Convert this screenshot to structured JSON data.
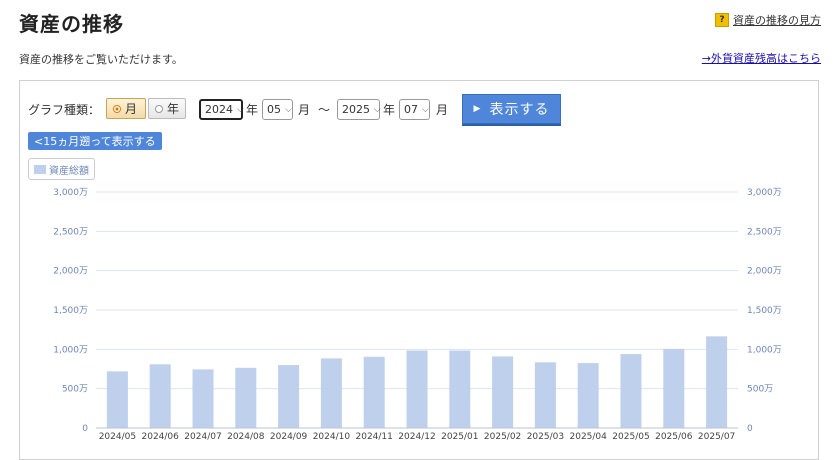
{
  "header": {
    "title": "資産の推移",
    "help_label": "資産の推移の見方",
    "help_icon": "question-icon",
    "subtitle": "資産の推移をご覧いただけます。",
    "fx_link": "→外貨資産残高はこちら"
  },
  "controls": {
    "graph_type_label": "グラフ種類：",
    "radio_month": "月",
    "radio_year": "年",
    "selected": "月",
    "from_year": "2024",
    "from_month": "05",
    "to_year": "2025",
    "to_month": "07",
    "year_unit": "年",
    "month_unit": "月",
    "range_sep": "〜",
    "show_button": "表示する",
    "back_button": "<15ヵ月遡って表示する"
  },
  "chart_data": {
    "type": "bar",
    "legend": [
      "資産総額"
    ],
    "categories": [
      "2024/05",
      "2024/06",
      "2024/07",
      "2024/08",
      "2024/09",
      "2024/10",
      "2024/11",
      "2024/12",
      "2025/01",
      "2025/02",
      "2025/03",
      "2025/04",
      "2025/05",
      "2025/06",
      "2025/07"
    ],
    "series": [
      {
        "name": "資産総額",
        "values": [
          720,
          810,
          745,
          765,
          800,
          885,
          905,
          985,
          985,
          910,
          835,
          825,
          940,
          1005,
          1165
        ]
      }
    ],
    "ylim": [
      0,
      3000
    ],
    "yticks": [
      "0",
      "500万",
      "1,000万",
      "1,500万",
      "2,000万",
      "2,500万",
      "3,000万"
    ],
    "ytick_values": [
      0,
      500,
      1000,
      1500,
      2000,
      2500,
      3000
    ],
    "bar_color": "#bfd0ec",
    "grid": true
  }
}
